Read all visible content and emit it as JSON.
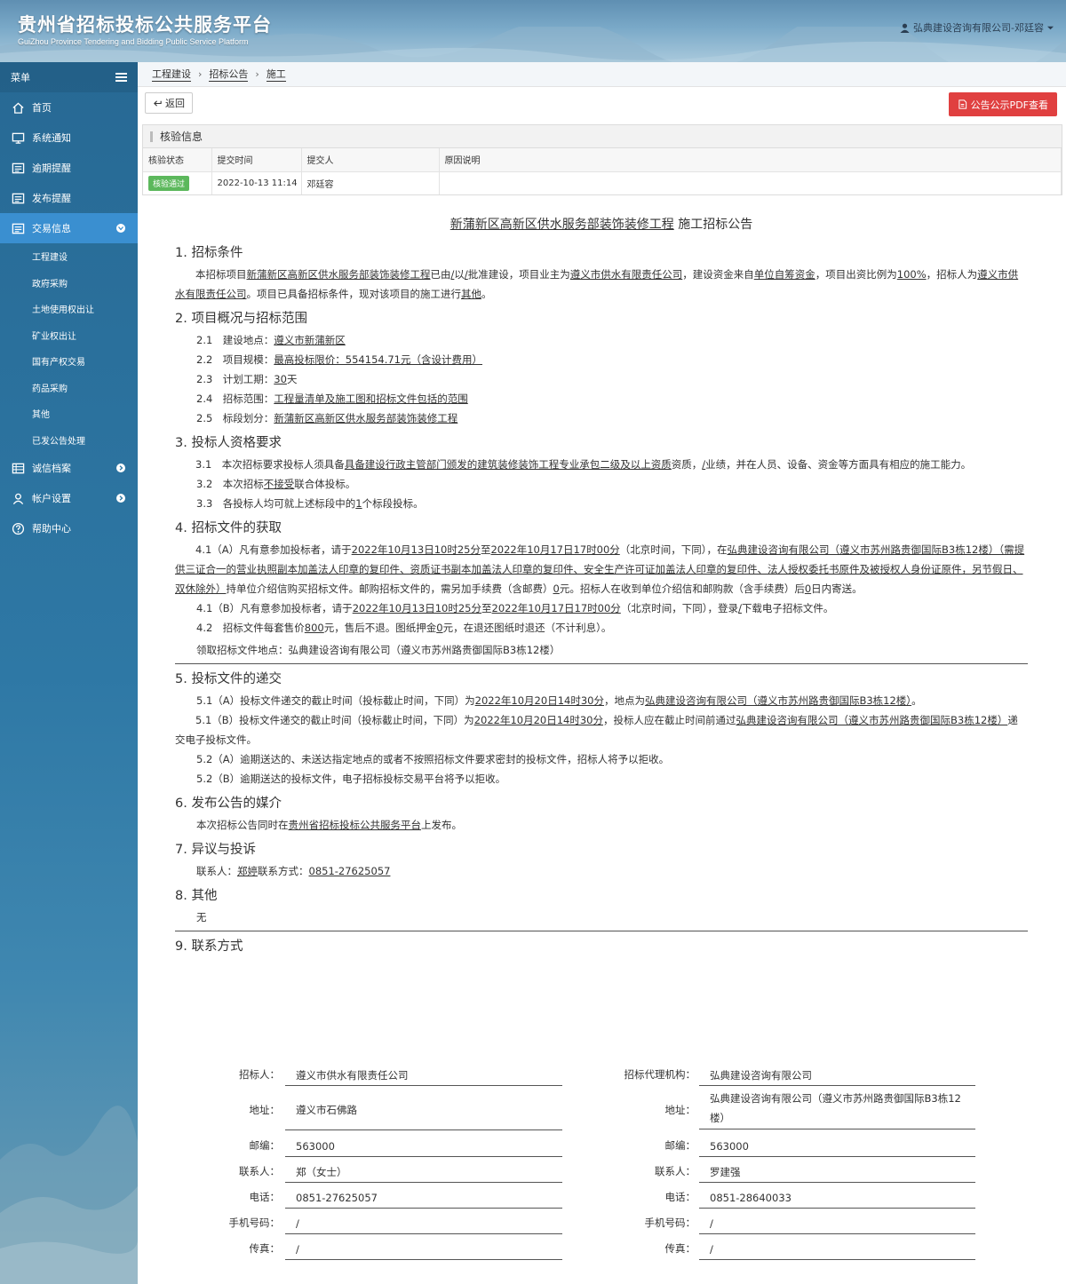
{
  "header": {
    "title_cn": "贵州省招标投标公共服务平台",
    "title_en": "GuiZhou Province Tendering and Bidding Public Service Platform",
    "user": "弘典建设咨询有限公司-邓廷容"
  },
  "sidebar": {
    "title": "菜单",
    "items": [
      {
        "label": "首页",
        "icon": "home-icon"
      },
      {
        "label": "系统通知",
        "icon": "monitor-icon"
      },
      {
        "label": "逾期提醒",
        "icon": "list-icon"
      },
      {
        "label": "发布提醒",
        "icon": "list-icon"
      },
      {
        "label": "交易信息",
        "icon": "list-icon",
        "active": true
      }
    ],
    "sub_items": [
      "工程建设",
      "政府采购",
      "土地使用权出让",
      "矿业权出让",
      "国有产权交易",
      "药品采购",
      "其他",
      "已发公告处理"
    ],
    "items2": [
      {
        "label": "诚信档案",
        "icon": "table-icon"
      },
      {
        "label": "帐户设置",
        "icon": "user-icon"
      },
      {
        "label": "帮助中心",
        "icon": "help-icon"
      }
    ]
  },
  "breadcrumb": [
    "工程建设",
    "招标公告",
    "施工"
  ],
  "toolbar": {
    "back_label": "返回",
    "pdf_label": "公告公示PDF查看"
  },
  "verify": {
    "title": "核验信息",
    "columns": [
      "核验状态",
      "提交时间",
      "提交人",
      "原因说明"
    ],
    "row": {
      "status": "核验通过",
      "time": "2022-10-13 11:14",
      "submitter": "邓廷容",
      "reason": ""
    }
  },
  "notice": {
    "title_u": "新蒲新区高新区供水服务部装饰装修工程",
    "title_rest": "施工招标公告",
    "s1": "1. 招标条件",
    "s1_p": [
      "本招标项目",
      "新蒲新区高新区供水服务部装饰装修工程",
      "已由",
      "/",
      "以",
      "/",
      "批准建设，项目业主为",
      "遵义市供水有限责任公司",
      "，建设资金来自",
      "单位自筹资金",
      "，项目出资比例为",
      "100%",
      "，招标人为",
      "遵义市供水有限责任公司",
      "。项目已具备招标条件，现对该项目的施工进行",
      "其他",
      "。"
    ],
    "s2": "2. 项目概况与招标范围",
    "s2_items": [
      {
        "k": "2.1　建设地点：",
        "v": "遵义市新蒲新区"
      },
      {
        "k": "2.2　项目规模：",
        "v": "最高投标限价：554154.71元（含设计费用）"
      },
      {
        "k": "2.3　计划工期：",
        "v": "30",
        "suffix": "天"
      },
      {
        "k": "2.4　招标范围：",
        "v": "工程量清单及施工图和招标文件包括的范围"
      },
      {
        "k": "2.5　标段划分：",
        "v": "新蒲新区高新区供水服务部装饰装修工程"
      }
    ],
    "s3": "3. 投标人资格要求",
    "s3_1": [
      "3.1　本次招标要求投标人须具备",
      "具备建设行政主管部门颁发的建筑装修装饰工程专业承包二级及以上资质",
      "资质，",
      "/",
      "业绩，并在人员、设备、资金等方面具有相应的施工能力。"
    ],
    "s3_2": [
      "3.2　本次招标",
      "不接受",
      "联合体投标。"
    ],
    "s3_3": [
      "3.3　各投标人均可就上述标段中的",
      "1",
      "个标段投标。"
    ],
    "s4": "4. 招标文件的获取",
    "s4_1a": [
      "4.1（A）凡有意参加投标者，请于",
      "2022年10月13日10时25分",
      "至",
      "2022年10月17日17时00分",
      "（北京时间，下同），在",
      "弘典建设咨询有限公司（遵义市苏州路贵御国际B3栋12楼）（需提供三证合一的营业执照副本加盖法人印章的复印件、资质证书副本加盖法人印章的复印件、安全生产许可证加盖法人印章的复印件、法人授权委托书原件及被授权人身份证原件，另节假日、双休除外）",
      "持单位介绍信购买招标文件。邮购招标文件的，需另加手续费（含邮费）",
      "0",
      "元。招标人在收到单位介绍信和邮购款（含手续费）后",
      "0",
      "日内寄送。"
    ],
    "s4_1b": [
      "4.1（B）凡有意参加投标者，请于",
      "2022年10月13日10时25分",
      "至",
      "2022年10月17日17时00分",
      "（北京时间，下同），登录",
      "/",
      "下载电子招标文件。"
    ],
    "s4_2": [
      "4.2　招标文件每套售价",
      "800",
      "元，售后不退。图纸押金",
      "0",
      "元，在退还图纸时退还（不计利息）。"
    ],
    "s4_loc": "领取招标文件地点：弘典建设咨询有限公司（遵义市苏州路贵御国际B3栋12楼）",
    "s5": "5. 投标文件的递交",
    "s5_1a": [
      "5.1（A）投标文件递交的截止时间（投标截止时间，下同）为",
      "2022年10月20日14时30分",
      "，地点为",
      "弘典建设咨询有限公司（遵义市苏州路贵御国际B3栋12楼）",
      "。"
    ],
    "s5_1b": [
      "5.1（B）投标文件递交的截止时间（投标截止时间，下同）为",
      "2022年10月20日14时30分",
      "，投标人应在截止时间前通过",
      "弘典建设咨询有限公司（遵义市苏州路贵御国际B3栋12楼）",
      "递交电子投标文件。"
    ],
    "s5_2a": "5.2（A）逾期送达的、未送达指定地点的或者不按照招标文件要求密封的投标文件，招标人将予以拒收。",
    "s5_2b": "5.2（B）逾期送达的投标文件，电子招标投标交易平台将予以拒收。",
    "s6": "6. 发布公告的媒介",
    "s6_p": [
      "本次招标公告同时在",
      "贵州省招标投标公共服务平台",
      "上发布。"
    ],
    "s7": "7. 异议与投诉",
    "s7_p": [
      "联系人：",
      "郑婷",
      "联系方式：",
      "0851-27625057"
    ],
    "s8": "8. 其他",
    "s8_p": "无",
    "s9": "9. 联系方式"
  },
  "contact": {
    "left_labels": [
      "招标人：",
      "地址：",
      "邮编：",
      "联系人：",
      "电话：",
      "手机号码：",
      "传真："
    ],
    "left_values": [
      "遵义市供水有限责任公司",
      "遵义市石佛路",
      "563000",
      "郑（女士）",
      "0851-27625057",
      "/",
      "/"
    ],
    "right_labels": [
      "招标代理机构：",
      "地址：",
      "邮编：",
      "联系人：",
      "电话：",
      "手机号码：",
      "传真："
    ],
    "right_values": [
      "弘典建设咨询有限公司",
      "弘典建设咨询有限公司（遵义市苏州路贵御国际B3栋12楼）",
      "563000",
      "罗建强",
      "0851-28640033",
      "/",
      "/"
    ]
  }
}
